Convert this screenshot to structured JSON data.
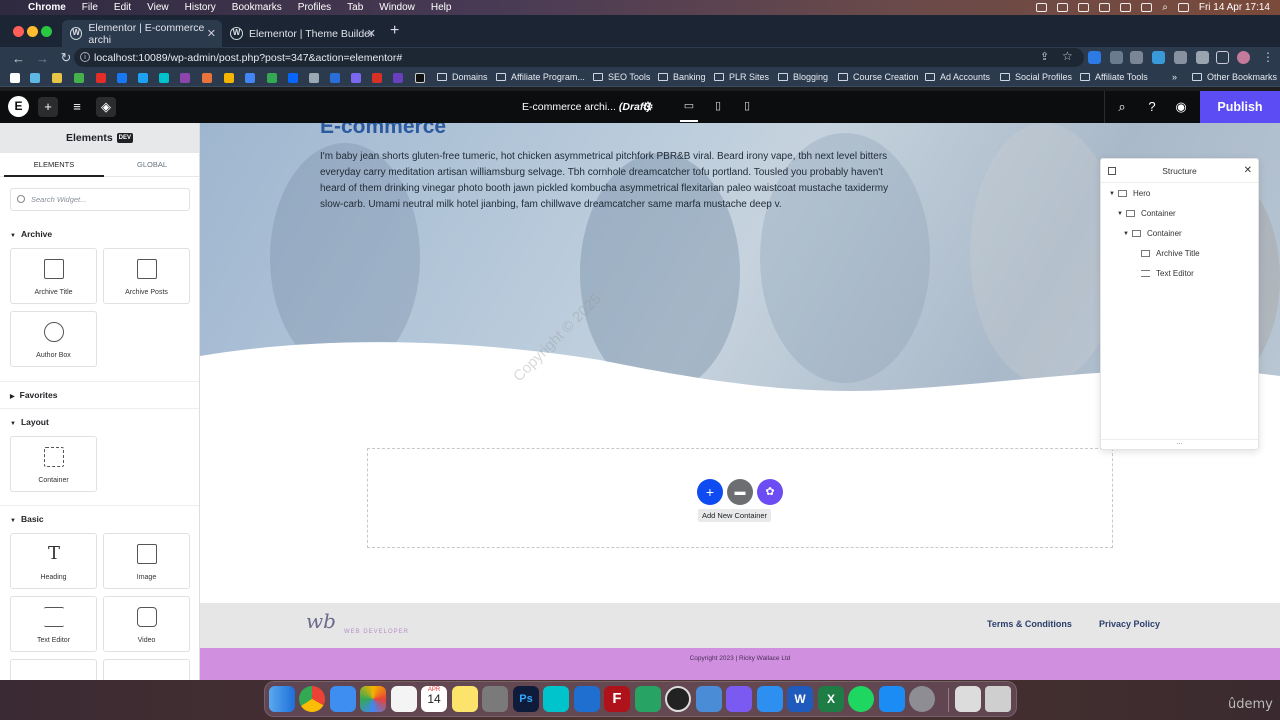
{
  "menubar": {
    "app": "Chrome",
    "items": [
      "File",
      "Edit",
      "View",
      "History",
      "Bookmarks",
      "Profiles",
      "Tab",
      "Window",
      "Help"
    ],
    "clock": "Fri 14 Apr 17:14"
  },
  "tabs": [
    {
      "title": "Elementor | E-commerce archi",
      "active": true
    },
    {
      "title": "Elementor | Theme Builder",
      "active": false
    }
  ],
  "address": {
    "url": "localhost:10089/wp-admin/post.php?post=347&action=elementor#"
  },
  "bookmarks": {
    "folders": [
      "Domains",
      "Affiliate Program...",
      "SEO Tools",
      "Banking",
      "PLR Sites",
      "Blogging",
      "Course Creation",
      "Ad Accounts",
      "Social Profiles",
      "Affiliate Tools"
    ],
    "more": "»",
    "other": "Other Bookmarks"
  },
  "editor": {
    "doc_title": "E-commerce archi...",
    "doc_status": "(Draft)",
    "publish_label": "Publish"
  },
  "panel": {
    "title": "Elements",
    "badge": "DEV",
    "tabs": [
      "ELEMENTS",
      "GLOBAL"
    ],
    "search_placeholder": "Search Widget...",
    "categories": [
      {
        "name": "Archive",
        "widgets": [
          "Archive Title",
          "Archive Posts",
          "Author Box"
        ]
      },
      {
        "name": "Favorites",
        "widgets": []
      },
      {
        "name": "Layout",
        "widgets": [
          "Container"
        ]
      },
      {
        "name": "Basic",
        "widgets": [
          "Heading",
          "Image",
          "Text Editor",
          "Video"
        ]
      }
    ]
  },
  "hero": {
    "title": "E-commerce",
    "text": "I'm baby jean shorts gluten-free tumeric, hot chicken asymmetrical pitchfork PBR&B viral. Beard irony vape, tbh next level bitters everyday carry meditation artisan williamsburg selvage. Tbh cornhole dreamcatcher tofu portland. Tousled you probably haven't heard of them drinking vinegar photo booth jawn pickled kombucha asymmetrical flexitarian paleo waistcoat mustache taxidermy slow-carb. Umami neutral milk hotel jianbing, fam chillwave dreamcatcher same marfa mustache deep v."
  },
  "watermark": "Copyright © 2025",
  "dropzone": {
    "tooltip": "Add New Container"
  },
  "footer": {
    "logo_mark": "wb",
    "logo_sub": "WEB DEVELOPER",
    "links": [
      "Terms & Conditions",
      "Privacy Policy"
    ],
    "copyright": "Copyright 2023 | Ricky Wallace Ltd"
  },
  "structure": {
    "title": "Structure",
    "footer": "...",
    "tree": [
      {
        "label": "Hero",
        "level": 0
      },
      {
        "label": "Container",
        "level": 1
      },
      {
        "label": "Container",
        "level": 2
      },
      {
        "label": "Archive Title",
        "level": 3
      },
      {
        "label": "Text Editor",
        "level": 3
      }
    ]
  },
  "dock": {
    "calendar_month": "APR",
    "calendar_day": "14",
    "watermark": "ûdemy"
  },
  "colors": {
    "accent": "#5b4df3",
    "footer_pink": "#d18fe0",
    "hero_title": "#2c5aa0",
    "add_button": "#0e4bf1"
  }
}
